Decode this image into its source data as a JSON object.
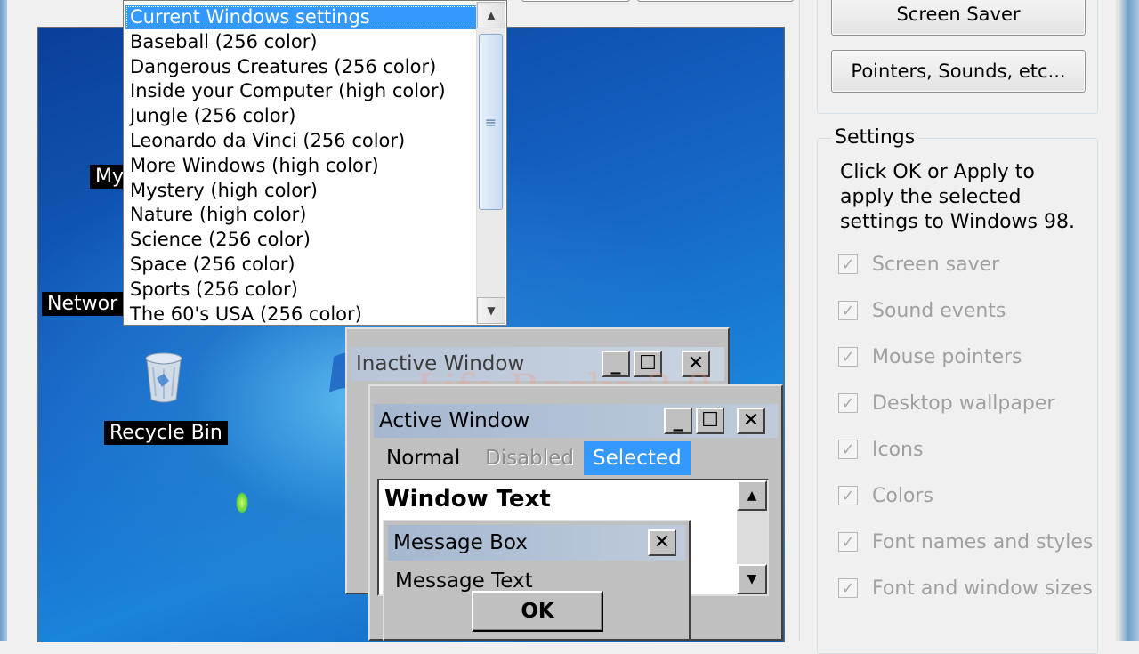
{
  "theme_list": {
    "items": [
      "Current Windows settings",
      "Baseball (256 color)",
      "Dangerous Creatures (256 color)",
      "Inside your Computer (high color)",
      "Jungle (256 color)",
      "Leonardo da Vinci (256 color)",
      "More Windows (high color)",
      "Mystery (high color)",
      "Nature (high color)",
      "Science (256 color)",
      "Space (256 color)",
      "Sports (256 color)",
      "The 60's USA (256 color)"
    ],
    "selected_index": 0
  },
  "buttons": {
    "screen_saver": "Screen Saver",
    "pointers_sounds": "Pointers, Sounds, etc..."
  },
  "desktop": {
    "icon_my": "My",
    "icon_network": "Networ",
    "icon_recycle": "Recycle Bin",
    "watermark": "Life Rocks 2.0"
  },
  "inactive_window": {
    "title": "Inactive Window"
  },
  "active_window": {
    "title": "Active Window",
    "menu": [
      "Normal",
      "Disabled",
      "Selected"
    ],
    "window_text": "Window Text"
  },
  "message_box": {
    "title": "Message Box",
    "text": "Message Text",
    "ok": "OK"
  },
  "settings": {
    "legend": "Settings",
    "description": "Click OK or Apply to apply the selected settings to Windows 98.",
    "options": [
      {
        "label": "Screen saver",
        "checked": true
      },
      {
        "label": "Sound events",
        "checked": true
      },
      {
        "label": "Mouse pointers",
        "checked": true
      },
      {
        "label": "Desktop wallpaper",
        "checked": true
      },
      {
        "label": "Icons",
        "checked": true
      },
      {
        "label": "Colors",
        "checked": true
      },
      {
        "label": "Font names and styles",
        "checked": true
      },
      {
        "label": "Font and window sizes",
        "checked": true
      }
    ]
  },
  "colors": {
    "selection": "#3399ff",
    "title_active": "#a8b8d0",
    "title_inactive": "#bcc8d8"
  }
}
